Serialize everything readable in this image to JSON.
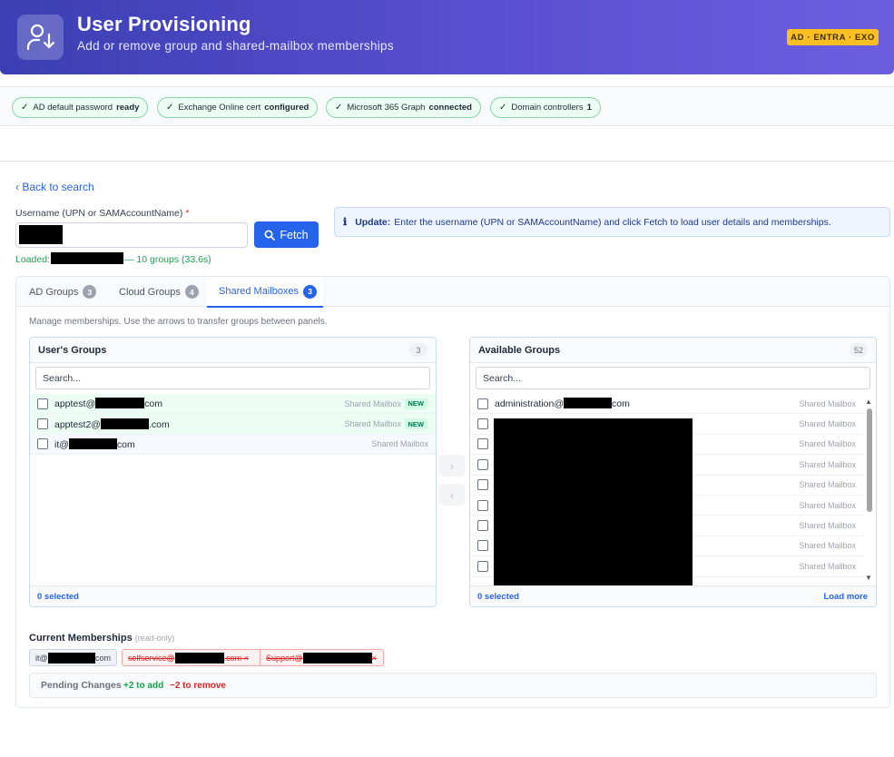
{
  "header": {
    "title": "User Provisioning",
    "subtitle": "Add or remove group and shared-mailbox memberships",
    "badge": "AD · ENTRA · EXO",
    "icon": "user-download-icon",
    "gradient": [
      "#3b3fb3",
      "#6d5ee0"
    ]
  },
  "status": {
    "items": [
      {
        "label": "AD default password",
        "value": "ready"
      },
      {
        "label": "Exchange Online cert",
        "value": "configured"
      },
      {
        "label": "Microsoft 365 Graph",
        "value": "connected"
      },
      {
        "label": "Domain controllers",
        "value": "1"
      }
    ],
    "check": "✓"
  },
  "nav": {
    "back": "‹ Back to search"
  },
  "user_form": {
    "label": "Username (UPN or SAMAccountName)",
    "required_mark": "*",
    "fetch_label": "Fetch",
    "loaded_prefix": "Loaded:",
    "loaded_suffix": "— 10 groups (33.6s)"
  },
  "info": {
    "icon": "ℹ",
    "title": "Update:",
    "text": "Enter the username (UPN or SAMAccountName) and click Fetch to load user details and memberships."
  },
  "tabs": [
    {
      "label": "AD Groups",
      "count": "3"
    },
    {
      "label": "Cloud Groups",
      "count": "4"
    },
    {
      "label": "Shared Mailboxes",
      "count": "3",
      "active": true
    }
  ],
  "hint": "Manage memberships. Use the arrows to transfer groups between panels.",
  "users_groups": {
    "title": "User's Groups",
    "count": "3",
    "search_placeholder": "Search...",
    "rows": [
      {
        "prefix": "apptest@",
        "suffix": "com",
        "type": "Shared Mailbox",
        "badge": "NEW"
      },
      {
        "prefix": "apptest2@",
        "suffix": ".com",
        "type": "Shared Mailbox",
        "badge": "NEW"
      },
      {
        "prefix": "it@",
        "suffix": "com",
        "type": "Shared Mailbox",
        "badge": ""
      }
    ],
    "selected": "0 selected"
  },
  "available_groups": {
    "title": "Available Groups",
    "count": "52",
    "search_placeholder": "Search...",
    "rows": [
      {
        "prefix": "administration@",
        "suffix": "com",
        "type": "Shared Mailbox"
      },
      {
        "prefix": "",
        "suffix": "",
        "type": "Shared Mailbox"
      },
      {
        "prefix": "",
        "suffix": "",
        "type": "Shared Mailbox"
      },
      {
        "prefix": "",
        "suffix": "",
        "type": "Shared Mailbox"
      },
      {
        "prefix": "",
        "suffix": "",
        "type": "Shared Mailbox"
      },
      {
        "prefix": "",
        "suffix": "",
        "type": "Shared Mailbox"
      },
      {
        "prefix": "",
        "suffix": "",
        "type": "Shared Mailbox"
      },
      {
        "prefix": "",
        "suffix": "",
        "type": "Shared Mailbox"
      },
      {
        "prefix": "",
        "suffix": "",
        "type": "Shared Mailbox"
      }
    ],
    "selected": "0 selected",
    "load_more": "Load more"
  },
  "transfer": {
    "right": "›",
    "left": "‹"
  },
  "current_memberships": {
    "title": "Current Memberships",
    "note": "(read-only)",
    "chips": [
      {
        "prefix": "it@",
        "suffix": "com",
        "state": "keep"
      },
      {
        "prefix": "selfservice@",
        "suffix": ".com ×",
        "state": "remove"
      },
      {
        "prefix": "Support@",
        "suffix": "×",
        "state": "remove"
      }
    ]
  },
  "pending": {
    "title": "Pending Changes",
    "add": "+2 to add",
    "remove": "−2 to remove"
  }
}
